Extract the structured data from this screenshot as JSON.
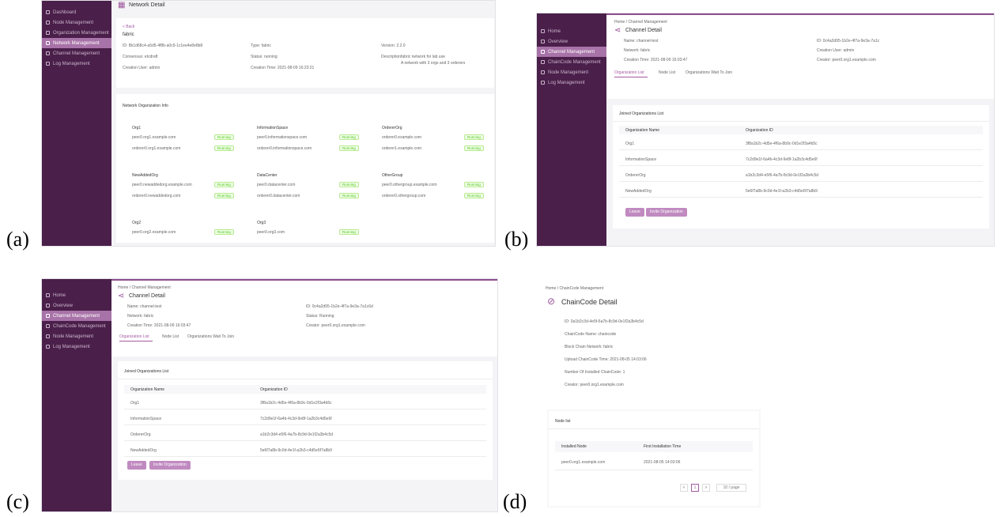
{
  "panels": {
    "a": {
      "letter": "(a)",
      "sidebar": [
        "Dashboard",
        "Node Management",
        "Organization Management",
        "Network Management",
        "Channel Management",
        "Log Management"
      ],
      "page_title": "Network Detail",
      "back": "< Back",
      "network_name": "fabric",
      "id": "ID: 8b1d68c4-a5d5-4f8b-a0c9-1c1ee4e8e8b8",
      "consensus": "Consensus: etcdraft",
      "creation_user": "Creation User: admin",
      "type": "Type: fabric",
      "status": "Status: running",
      "creation_time": "Creation Time: 2021-08-09 16:23:21",
      "version": "Version: 2.2.0",
      "desc_label": "Description:",
      "desc_value": "fabric network for lab use",
      "desc_more": "A network with 3 orgs and 3 orderers",
      "org_section_title": "Network Organization Info",
      "orgs": [
        {
          "name": "Org1",
          "nodes": [
            "peer0.org1.example.com",
            "orderer0.org1.example.com"
          ],
          "status": "Running"
        },
        {
          "name": "InformationSpace",
          "nodes": [
            "peer0.informationspace.com",
            "orderer0.informationspace.com"
          ],
          "status": "Running"
        },
        {
          "name": "OrdererOrg",
          "nodes": [
            "orderer0.example.com",
            "orderer1.example.com"
          ],
          "status": "Running"
        },
        {
          "name": "NewAddedOrg",
          "nodes": [
            "peer0.newaddedorg.example.com",
            "orderer0.newaddedorg.com"
          ],
          "status": "Running"
        },
        {
          "name": "DataCenter",
          "nodes": [
            "peer0.datacenter.com",
            "orderer0.datacenter.com"
          ],
          "status": "Running"
        },
        {
          "name": "OtherGroup",
          "nodes": [
            "peer0.othergroup.example.com",
            "orderer0.othergroup.com"
          ],
          "status": "Running"
        },
        {
          "name": "Org2",
          "nodes": [
            "peer0.org2.example.com"
          ],
          "status": "Running"
        },
        {
          "name": "Org3",
          "nodes": [
            "peer0.org3.com"
          ],
          "status": "Running"
        }
      ]
    },
    "b": {
      "letter": "(b)",
      "sidebar": [
        "Home",
        "Overview",
        "Channel Management",
        "ChainCode Management",
        "Node Management",
        "Log Management"
      ],
      "breadcrumb": "Home / Channel Management",
      "page_title": "Channel Detail",
      "name": "Name: channel-test",
      "network": "Network: fabric",
      "creation_time": "Creation Time: 2021-08-09 16:03:47",
      "id": "ID: 0c4a2d95-1b2e-4f7a-9e3a-7a1c",
      "creation_user": "Creation User: admin",
      "creator": "Creator: peer0.org1.example.com",
      "tabs": [
        "Organization List",
        "Node List",
        "Organizations Wait To Join"
      ],
      "list_title": "Joined Organizations List",
      "col_name": "Organization Name",
      "col_id": "Organization ID",
      "rows": [
        [
          "Org1",
          "3f8a1b2c-4d5e-4f6a-8b9c-0d1e2f3a4b5c"
        ],
        [
          "InformationSpace",
          "7c2d9e1f-6a4b-4c3d-9e8f-1a2b3c4d5e6f"
        ],
        [
          "OrdererOrg",
          "a1b2c3d4-e5f6-4a7b-8c9d-0e1f2a3b4c5d"
        ],
        [
          "NewAddedOrg",
          "5e6f7a8b-9c0d-4e1f-a2b3-c4d5e6f7a8b9"
        ]
      ],
      "btn_leave": "Leave",
      "btn_invite": "Invite Organization"
    },
    "c": {
      "letter": "(c)",
      "sidebar": [
        "Home",
        "Overview",
        "Channel Management",
        "ChainCode Management",
        "Node Management",
        "Log Management"
      ],
      "breadcrumb": "Home / Channel Management",
      "page_title": "Channel Detail",
      "name": "Name: channel-test",
      "network": "Network: fabric",
      "creation_time": "Creation Time: 2021-08-09 16:03:47",
      "id": "ID: 0c4a2d95-1b2e-4f7a-9e3a-7a1c6d",
      "status": "Status: Running",
      "creator": "Creator: peer0.org1.example.com",
      "tabs": [
        "Organization List",
        "Node List",
        "Organizations Wait To Join"
      ],
      "list_title": "Joined Organizations List",
      "col_name": "Organization Name",
      "col_id": "Organization ID",
      "rows": [
        [
          "Org1",
          "3f8a1b2c-4d5e-4f6a-8b9c-0d1e2f3a4b5c"
        ],
        [
          "InformationSpace",
          "7c2d9e1f-6a4b-4c3d-9e8f-1a2b3c4d5e6f"
        ],
        [
          "OrdererOrg",
          "a1b2c3d4-e5f6-4a7b-8c9d-0e1f2a3b4c5d"
        ],
        [
          "NewAddedOrg",
          "5e6f7a8b-9c0d-4e1f-a2b3-c4d5e6f7a8b9"
        ]
      ],
      "btn_leave": "Leave",
      "btn_invite": "Invite Organization"
    },
    "d": {
      "letter": "(d)",
      "breadcrumb": "Home / ChainCode Management",
      "page_title": "ChainCode Detail",
      "fields": [
        "ID: 0a1b2c3d-4e5f-6a7b-8c9d-0e1f2a3b4c5d",
        "ChainCode Name: chaincode",
        "Block Chain Network: fabric",
        "Upload ChainCode Time: 2021-08-05 14:03:06",
        "Number Of Installed ChainCode: 1",
        "Creator: peer0.org1.example.com"
      ],
      "node_list_title": "Node list",
      "col_node": "Installed Node",
      "col_time": "First Installation Time",
      "row": [
        "peer0.org1.example.com",
        "2021-08-05 14:03:06"
      ],
      "pager": [
        "<",
        "1",
        ">"
      ],
      "page_size": "10 / page"
    }
  }
}
